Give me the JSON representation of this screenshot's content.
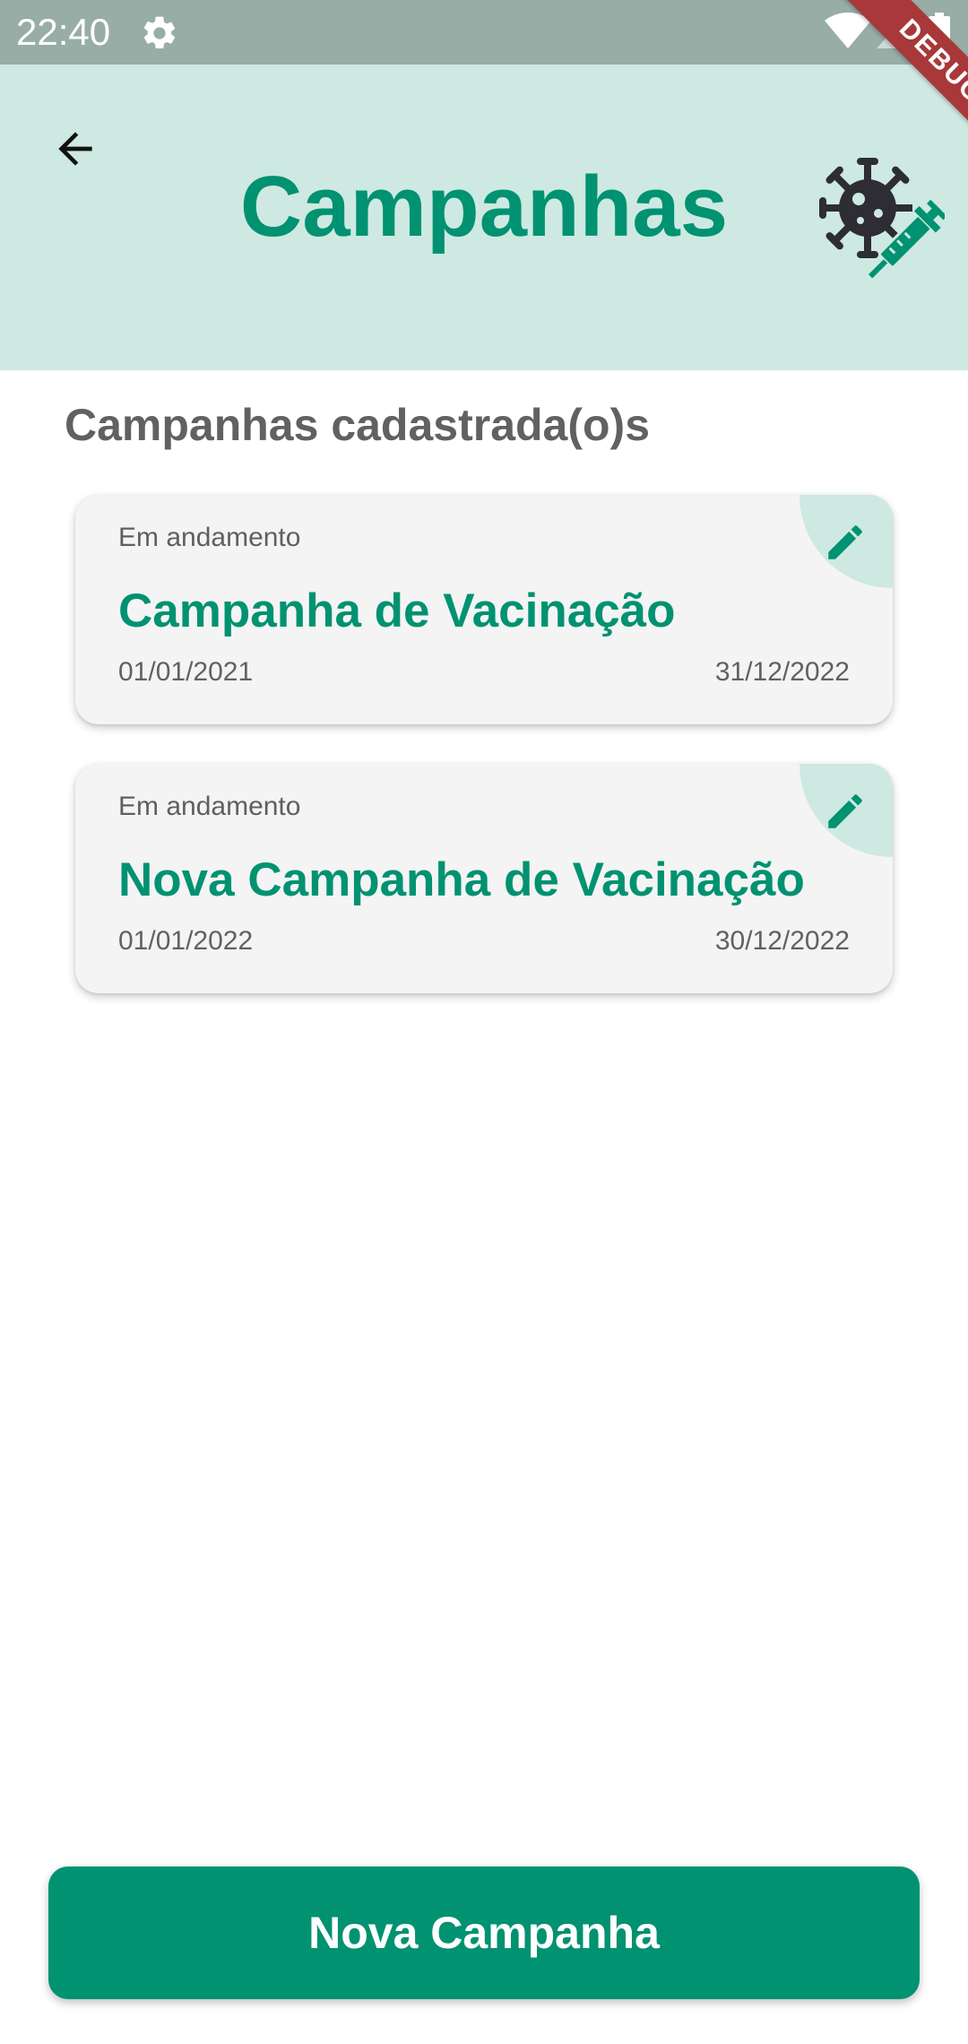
{
  "status_bar": {
    "time": "22:40",
    "icons": [
      "gear-icon",
      "wifi-icon",
      "signal-icon",
      "battery-icon"
    ],
    "debug_label": "DEBUG"
  },
  "app_bar": {
    "title": "Campanhas",
    "back_icon": "arrow-left-icon",
    "logo_icon": "virus-syringe-icon",
    "background_color": "#cde9e2",
    "title_color": "#009271"
  },
  "section": {
    "title": "Campanhas cadastrada(o)s"
  },
  "campaigns": [
    {
      "status": "Em andamento",
      "name": "Campanha de Vacinação",
      "start_date": "01/01/2021",
      "end_date": "31/12/2022",
      "edit_icon": "pencil-icon"
    },
    {
      "status": "Em andamento",
      "name": "Nova Campanha de Vacinação",
      "start_date": "01/01/2022",
      "end_date": "30/12/2022",
      "edit_icon": "pencil-icon"
    }
  ],
  "actions": {
    "new_campaign_label": "Nova Campanha",
    "button_color": "#009271"
  }
}
